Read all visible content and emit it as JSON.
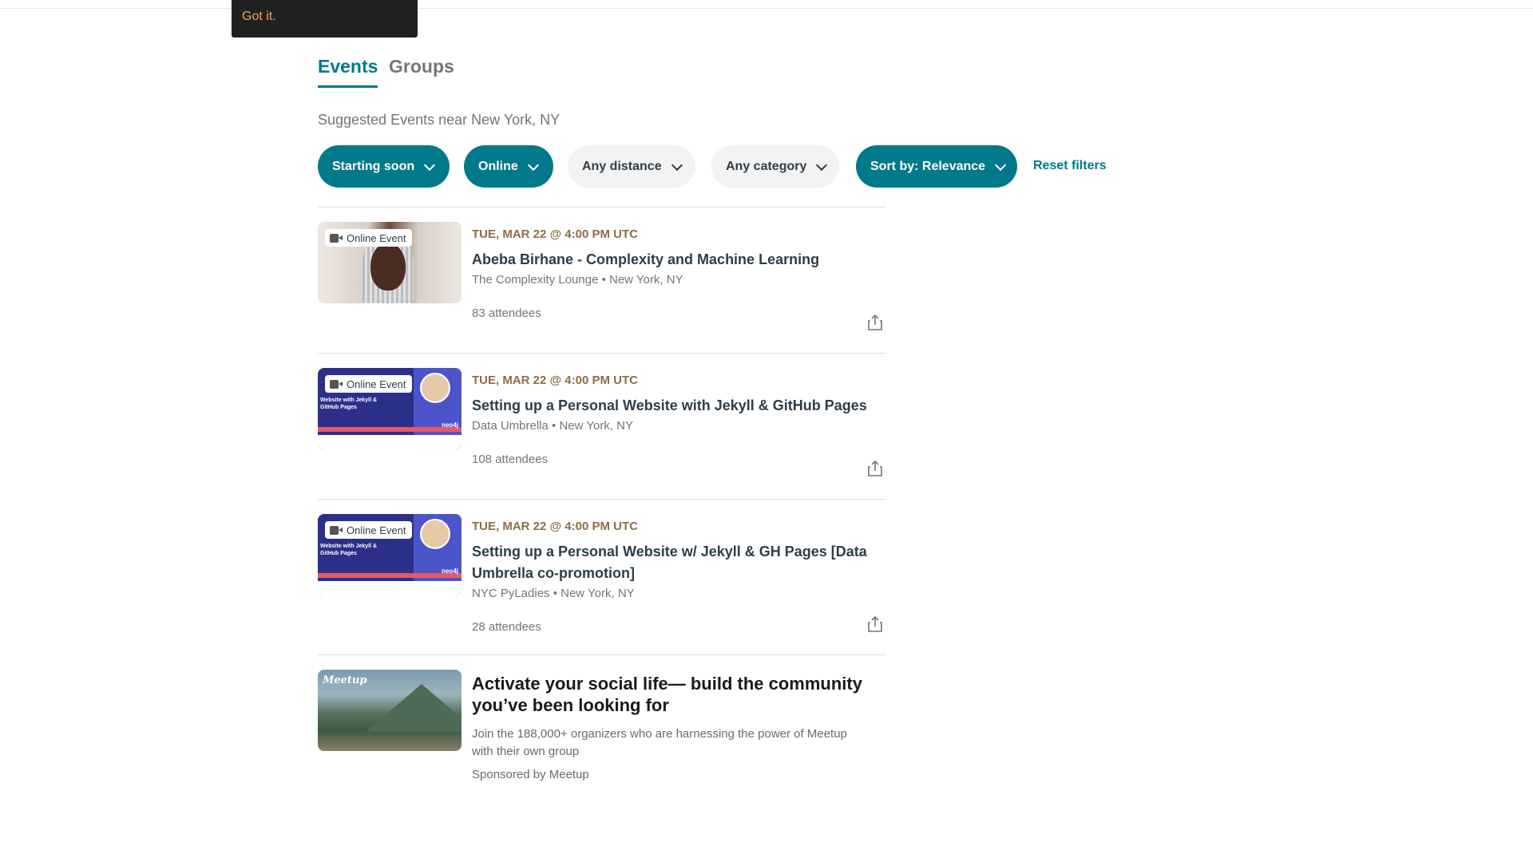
{
  "toast": {
    "link": "Got it."
  },
  "tabs": [
    {
      "label": "Events",
      "active": true
    },
    {
      "label": "Groups",
      "active": false
    }
  ],
  "subtitle": "Suggested Events near New York, NY",
  "filters": {
    "items": [
      {
        "label": "Starting soon",
        "active": true
      },
      {
        "label": "Online",
        "active": true
      },
      {
        "label": "Any distance",
        "active": false
      },
      {
        "label": "Any category",
        "active": false
      },
      {
        "label": "Sort by: Relevance",
        "active": true
      }
    ],
    "reset_label": "Reset filters"
  },
  "events": [
    {
      "badge": "Online Event",
      "date": "TUE, MAR 22 @ 4:00 PM UTC",
      "title": "Abeba Birhane - Complexity and Machine Learning",
      "org": "The Complexity Lounge • New York, NY",
      "attendees": "83 attendees",
      "thumb_icon": "portrait-photo"
    },
    {
      "badge": "Online Event",
      "date": "TUE, MAR 22 @ 4:00 PM UTC",
      "title": "Setting up a Personal Website with Jekyll & GitHub Pages",
      "org": "Data Umbrella • New York, NY",
      "attendees": "108 attendees",
      "thumb_text": "Website with Jekyll & GitHub Pages",
      "thumb_logo": "neo4j"
    },
    {
      "badge": "Online Event",
      "date": "TUE, MAR 22 @ 4:00 PM UTC",
      "title": "Setting up a Personal Website w/ Jekyll & GH Pages [Data Umbrella co-promotion]",
      "org": "NYC PyLadies • New York, NY",
      "attendees": "28 attendees",
      "thumb_text": "Website with Jekyll & GitHub Pages",
      "thumb_logo": "neo4j"
    }
  ],
  "promo": {
    "logo": "Meetup",
    "title": "Activate your social life— build the community you’ve been looking for",
    "description": "Join the 188,000+ organizers who are harnessing the power of Meetup with their own group",
    "sponsor": "Sponsored by Meetup"
  },
  "colors": {
    "accent": "#00798a",
    "date": "#8c6d46",
    "toast_bg": "#212121",
    "toast_link": "#f0a35b"
  }
}
